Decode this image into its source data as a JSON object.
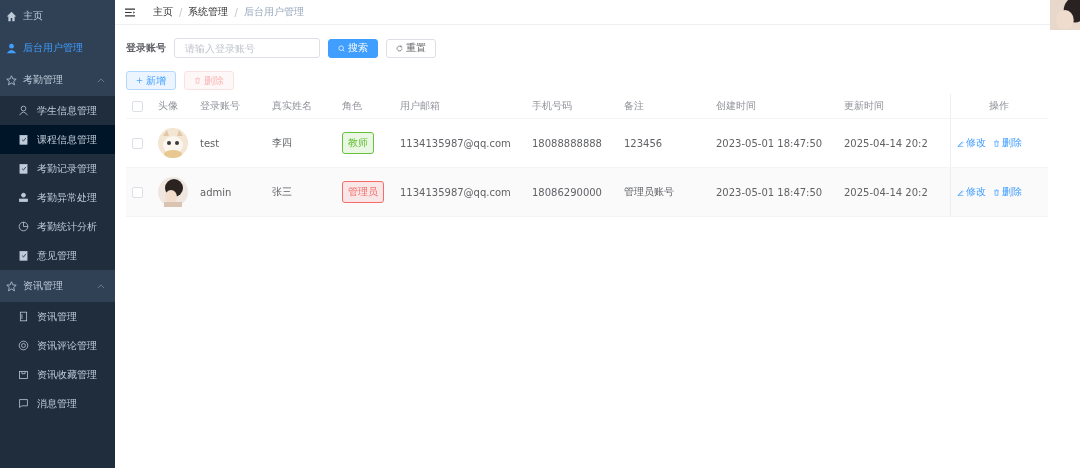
{
  "sidebar": {
    "items": [
      {
        "kind": "link",
        "label": "主页",
        "selected": false
      },
      {
        "kind": "link",
        "label": "后台用户管理",
        "selected": true
      },
      {
        "kind": "group",
        "label": "考勤管理",
        "expanded": true,
        "children": [
          {
            "label": "学生信息管理",
            "hovered": false
          },
          {
            "label": "课程信息管理",
            "hovered": true
          },
          {
            "label": "考勤记录管理",
            "hovered": false
          },
          {
            "label": "考勤异常处理",
            "hovered": false
          },
          {
            "label": "考勤统计分析",
            "hovered": false
          },
          {
            "label": "意见管理",
            "hovered": false
          }
        ]
      },
      {
        "kind": "group",
        "label": "资讯管理",
        "expanded": true,
        "children": [
          {
            "label": "资讯管理",
            "hovered": false
          },
          {
            "label": "资讯评论管理",
            "hovered": false
          },
          {
            "label": "资讯收藏管理",
            "hovered": false
          },
          {
            "label": "消息管理",
            "hovered": false
          }
        ]
      }
    ]
  },
  "breadcrumb": [
    "主页",
    "系统管理",
    "后台用户管理"
  ],
  "breadcrumb_separator": "/",
  "search": {
    "label": "登录账号",
    "placeholder": "请输入登录账号",
    "search_button": "搜索",
    "reset_button": "重置"
  },
  "actions": {
    "add": "新增",
    "delete": "删除",
    "delete_disabled": true
  },
  "table": {
    "all_checked": false,
    "columns": [
      "头像",
      "登录账号",
      "真实姓名",
      "角色",
      "用户邮箱",
      "手机号码",
      "备注",
      "创建时间",
      "更新时间",
      "操作"
    ],
    "rows": [
      {
        "checked": false,
        "account": "test",
        "name": "李四",
        "role": {
          "text": "教师",
          "color": "#67c23a"
        },
        "email": "1134135987@qq.com",
        "phone": "18088888888",
        "note": "123456",
        "created": "2023-05-01 18:47:50",
        "updated": "2025-04-14 20:2",
        "edit": "修改",
        "delete": "删除"
      },
      {
        "checked": false,
        "account": "admin",
        "name": "张三",
        "role": {
          "text": "管理员",
          "color": "#f56c6c"
        },
        "email": "1134135987@qq.com",
        "phone": "18086290000",
        "note": "管理员账号",
        "created": "2023-05-01 18:47:50",
        "updated": "2025-04-14 20:2",
        "edit": "修改",
        "delete": "删除"
      }
    ]
  }
}
